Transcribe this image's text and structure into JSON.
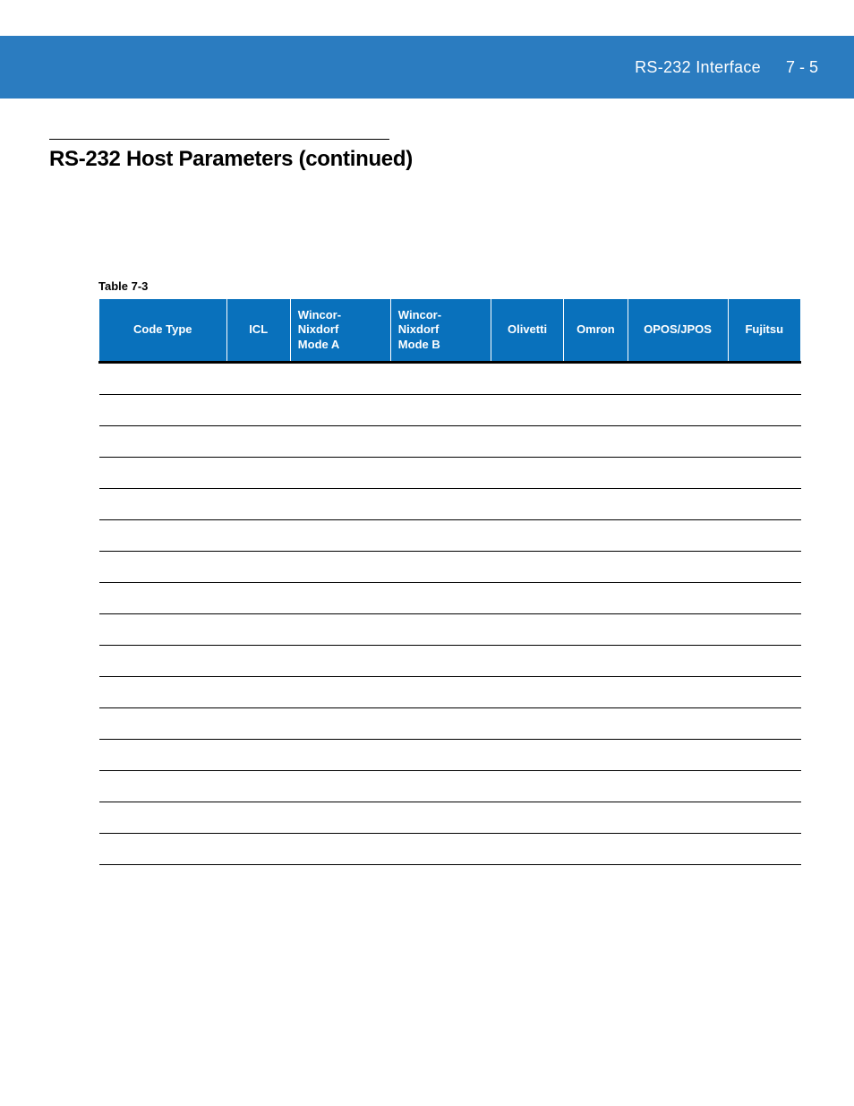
{
  "header": {
    "chapter_title": "RS-232 Interface",
    "page_number": "7 - 5"
  },
  "section": {
    "title": "RS-232 Host Parameters (continued)"
  },
  "table": {
    "label": "Table 7-3",
    "columns": [
      "Code Type",
      "ICL",
      "Wincor-Nixdorf Mode A",
      "Wincor-Nixdorf Mode B",
      "Olivetti",
      "Omron",
      "OPOS/JPOS",
      "Fujitsu"
    ],
    "rows": [
      [
        "",
        "",
        "",
        "",
        "",
        "",
        "",
        ""
      ],
      [
        "",
        "",
        "",
        "",
        "",
        "",
        "",
        ""
      ],
      [
        "",
        "",
        "",
        "",
        "",
        "",
        "",
        ""
      ],
      [
        "",
        "",
        "",
        "",
        "",
        "",
        "",
        ""
      ],
      [
        "",
        "",
        "",
        "",
        "",
        "",
        "",
        ""
      ],
      [
        "",
        "",
        "",
        "",
        "",
        "",
        "",
        ""
      ],
      [
        "",
        "",
        "",
        "",
        "",
        "",
        "",
        ""
      ],
      [
        "",
        "",
        "",
        "",
        "",
        "",
        "",
        ""
      ],
      [
        "",
        "",
        "",
        "",
        "",
        "",
        "",
        ""
      ],
      [
        "",
        "",
        "",
        "",
        "",
        "",
        "",
        ""
      ],
      [
        "",
        "",
        "",
        "",
        "",
        "",
        "",
        ""
      ],
      [
        "",
        "",
        "",
        "",
        "",
        "",
        "",
        ""
      ],
      [
        "",
        "",
        "",
        "",
        "",
        "",
        "",
        ""
      ],
      [
        "",
        "",
        "",
        "",
        "",
        "",
        "",
        ""
      ],
      [
        "",
        "",
        "",
        "",
        "",
        "",
        "",
        ""
      ],
      [
        "",
        "",
        "",
        "",
        "",
        "",
        "",
        ""
      ]
    ]
  }
}
